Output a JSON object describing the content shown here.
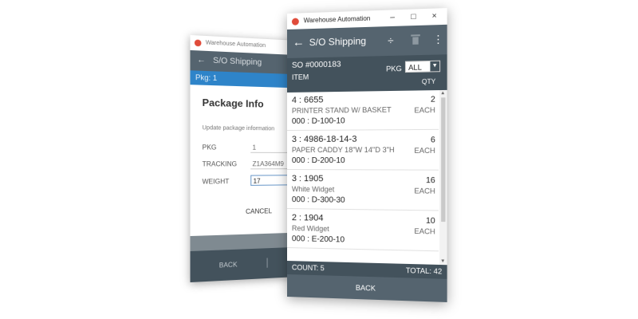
{
  "back_window": {
    "titlebar": {
      "app_title": "Warehouse Automation"
    },
    "appbar": {
      "back_icon": "arrow-left-icon",
      "title": "S/O Shipping"
    },
    "pkg_bar": {
      "label": "Pkg: 1"
    },
    "dialog": {
      "title": "Package Info",
      "subtitle": "Update package information",
      "fields": [
        {
          "label": "PKG",
          "value": "1"
        },
        {
          "label": "TRACKING",
          "value": "Z1A364M9"
        },
        {
          "label": "WEIGHT",
          "value": "17"
        }
      ],
      "cancel_label": "CANCEL"
    },
    "bottom": {
      "back_label": "BACK"
    }
  },
  "front_window": {
    "titlebar": {
      "app_title": "Warehouse Automation",
      "minimize": "–",
      "maximize": "□",
      "close": "×"
    },
    "appbar": {
      "back_icon": "arrow-left-icon",
      "title": "S/O Shipping",
      "divide_icon_glyph": "÷",
      "more_icon_glyph": "⋮"
    },
    "header": {
      "so_label": "SO #0000183",
      "item_label": "ITEM",
      "pkg_label": "PKG",
      "pkg_value": "ALL",
      "pkg_dropdown_glyph": "▼",
      "qty_label": "QTY"
    },
    "items": [
      {
        "code": "4 : 6655",
        "description": "PRINTER STAND W/ BASKET",
        "location": "000 : D-100-10",
        "qty": "2",
        "uom": "EACH"
      },
      {
        "code": "3 : 4986-18-14-3",
        "description": "PAPER CADDY 18\"W 14\"D 3\"H",
        "location": "000 : D-200-10",
        "qty": "6",
        "uom": "EACH"
      },
      {
        "code": "3 : 1905",
        "description": "White Widget",
        "location": "000 : D-300-30",
        "qty": "16",
        "uom": "EACH"
      },
      {
        "code": "2 : 1904",
        "description": "Red Widget",
        "location": "000 : E-200-10",
        "qty": "10",
        "uom": "EACH"
      }
    ],
    "footer": {
      "count": "COUNT:  5",
      "total": "TOTAL:  42"
    },
    "bottom": {
      "back_label": "BACK"
    }
  }
}
